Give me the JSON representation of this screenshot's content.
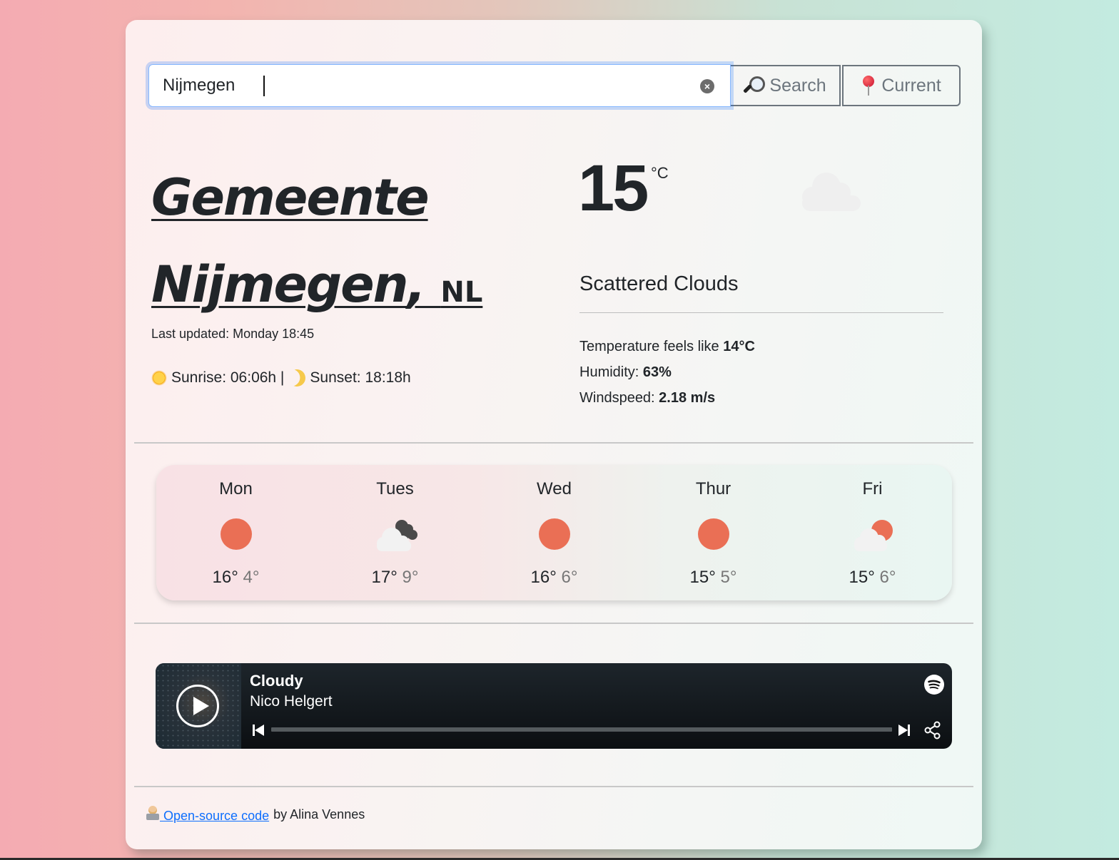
{
  "search": {
    "value": "Nijmegen",
    "clear_icon": "clear-icon",
    "search_button": {
      "label": "Search",
      "icon": "magnifier-icon"
    },
    "current_button": {
      "label": "Current",
      "icon": "pin-icon"
    }
  },
  "location": {
    "city_line1": "Gemeente",
    "city_line2": "Nijmegen",
    "comma": ",",
    "country": "NL",
    "last_updated": "Last updated: Monday 18:45",
    "sunrise_label": "Sunrise: 06:06h |",
    "sunset_label": "Sunset: 18:18h"
  },
  "current": {
    "temperature": "15",
    "unit": "°C",
    "icon": "cloud-icon",
    "description": "Scattered Clouds",
    "feels_like_label": "Temperature feels like ",
    "feels_like_value": "14°C",
    "humidity_label": "Humidity: ",
    "humidity_value": "63%",
    "wind_label": "Windspeed: ",
    "wind_value": "2.18 m/s"
  },
  "forecast": [
    {
      "day": "Mon",
      "icon": "sun-icon",
      "high": "16°",
      "low": "4°"
    },
    {
      "day": "Tues",
      "icon": "broken-clouds-icon",
      "high": "17°",
      "low": "9°"
    },
    {
      "day": "Wed",
      "icon": "sun-icon",
      "high": "16°",
      "low": "6°"
    },
    {
      "day": "Thur",
      "icon": "sun-icon",
      "high": "15°",
      "low": "5°"
    },
    {
      "day": "Fri",
      "icon": "partly-cloudy-icon",
      "high": "15°",
      "low": "6°"
    }
  ],
  "player": {
    "track": "Cloudy",
    "artist": "Nico Helgert",
    "progress": 0
  },
  "footer": {
    "link_text": "Open-source code",
    "suffix": "by Alina Vennes"
  },
  "colors": {
    "sun": "#ea6f55",
    "link": "#0d6efd",
    "focus_border": "#86b7fe",
    "button_gray": "#6c757d"
  }
}
